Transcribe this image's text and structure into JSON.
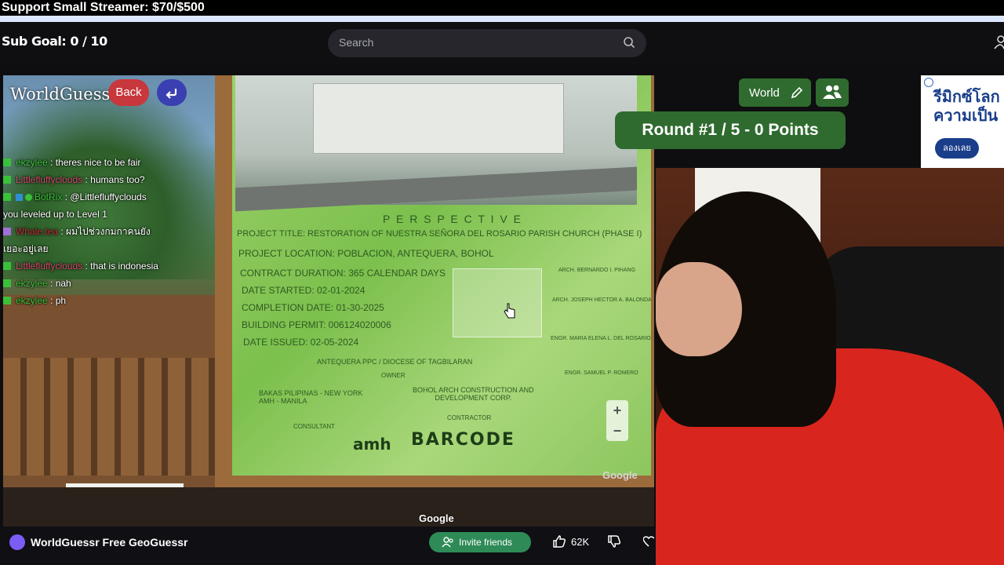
{
  "banner": {
    "text": "Support Small Streamer: $70/$500"
  },
  "header": {
    "sub_goal": "Sub Goal:  0 / 10",
    "search_placeholder": "Search"
  },
  "game": {
    "title": "WorldGuessr",
    "back_label": "Back",
    "mode_label": "World",
    "round_text": "Round #1 / 5 - 0 Points",
    "google_watermark": "Google",
    "google_small": "Google",
    "zoom_in": "+",
    "zoom_out": "−",
    "sign": {
      "heading": "P E R S P E C T I V E",
      "project_title": "PROJECT TITLE: RESTORATION OF NUESTRA SEÑORA DEL ROSARIO PARISH CHURCH (PHASE I)",
      "project_location": "PROJECT LOCATION: POBLACION, ANTEQUERA, BOHOL",
      "contract_duration": "CONTRACT DURATION: 365 CALENDAR DAYS",
      "date_started": "DATE STARTED: 02-01-2024",
      "completion_date": "COMPLETION DATE: 01-30-2025",
      "building_permit": "BUILDING PERMIT: 006124020006",
      "date_issued": "DATE ISSUED: 02-05-2024",
      "owner": "ANTEQUERA PPC / DIOCESE OF TAGBILARAN",
      "owner_role": "OWNER",
      "consultant": "BAKAS PILIPINAS - NEW YORK\nAMH - MANILA",
      "consultant_role": "CONSULTANT",
      "contractor": "BOHOL ARCH CONSTRUCTION AND\nDEVELOPMENT CORP.",
      "contractor_role": "CONTRACTOR",
      "arch1": "ARCH. BERNARDO I. PIHANG",
      "arch2": "ARCH. JOSEPH HECTOR A. BALONDA",
      "engr1": "ENGR. MARIA ELENA L. DEL ROSARIO",
      "engr2": "ENGR. SAMUEL P. ROMERO",
      "logo_amh": "amh",
      "logo_barcode": "BARCODE"
    }
  },
  "chat": [
    {
      "user": "ekzylee",
      "color": "#3ac13a",
      "text": ": theres nice to be fair"
    },
    {
      "user": "Littlefluffyclouds",
      "color": "#d64a6e",
      "text": ": humans too?"
    },
    {
      "user": "BotRix",
      "color": "#3ac13a",
      "text": ":  @Littlefluffyclouds you leveled up to Level 1"
    },
    {
      "user": "Whale.tea",
      "color": "#c0303a",
      "text": ": ผมไปช่วงกมกาคนยังเยอะอยู่เลย"
    },
    {
      "user": "Littlefluffyclouds",
      "color": "#d64a6e",
      "text": ": that is indonesia"
    },
    {
      "user": "ekzylee",
      "color": "#3ac13a",
      "text": ": nah"
    },
    {
      "user": "ekzylee",
      "color": "#3ac13a",
      "text": ": ph"
    }
  ],
  "ad": {
    "headline": "รีมิกซ์โลก\nความเป็น",
    "cta": "ลองเลย"
  },
  "footer": {
    "title": "WorldGuessr Free GeoGuessr",
    "invite_label": "Invite friends",
    "like_count": "62K"
  },
  "colors": {
    "accent_green": "#2f6b2f",
    "back_red": "#c7373c",
    "return_blue": "#3a3fb2",
    "invite_green": "#2e8b57"
  }
}
